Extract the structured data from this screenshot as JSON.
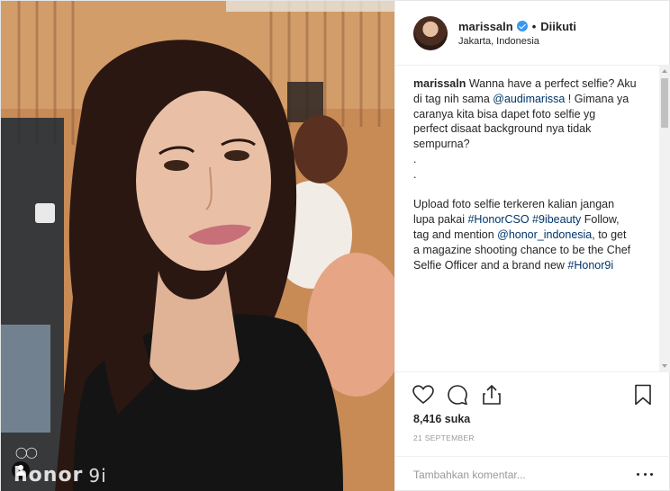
{
  "post": {
    "username": "marissaln",
    "follow_status": "Diikuti",
    "location": "Jakarta, Indonesia",
    "caption": {
      "username": "marissaln",
      "line1": " Wanna have a perfect selfie? Aku",
      "line2a": "di tag nih sama ",
      "mention1": "@audimarissa",
      "line2b": " ! Gimana ya",
      "line3": "caranya kita bisa dapet foto selfie yg",
      "line4": "perfect disaat background nya tidak",
      "line5": "sempurna?",
      "dot1": ".",
      "dot2": ".",
      "line6": "Upload foto selfie terkeren kalian jangan",
      "line7a": "lupa pakai ",
      "hashtag1": "#HonorCSO",
      "hashtag2": "#9ibeauty",
      "line7b": " Follow,",
      "line8a": "tag and mention ",
      "mention2": "@honor_indonesia",
      "line8b": ", to get",
      "line9": "a magazine shooting chance to be the Chef",
      "line10a": "Selfie Officer and a brand new ",
      "hashtag3": "#Honor9i"
    },
    "likes": "8,416 suka",
    "date": "21 SEPTEMBER",
    "comment_placeholder": "Tambahkan komentar...",
    "watermark": {
      "brand": "honor",
      "model": "9i",
      "rings": "◯◯"
    }
  },
  "icons": {
    "like": "heart-icon",
    "comment": "comment-icon",
    "share": "share-icon",
    "save": "bookmark-icon",
    "more": "more-options-icon",
    "verified": "verified-badge-icon"
  },
  "colors": {
    "link": "#003569",
    "verified": "#3897f0",
    "muted": "#999999",
    "text": "#262626"
  }
}
